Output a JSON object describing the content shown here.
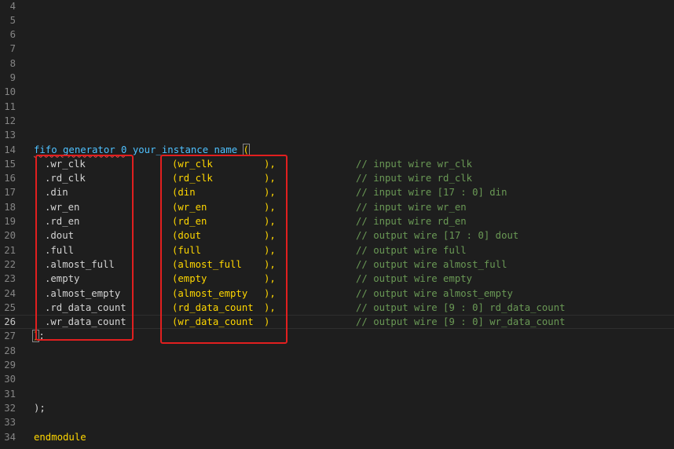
{
  "editor": {
    "empty_lines": [
      {
        "num": "4"
      },
      {
        "num": "5"
      },
      {
        "num": "6"
      },
      {
        "num": "7"
      },
      {
        "num": "8"
      },
      {
        "num": "9"
      },
      {
        "num": "10"
      },
      {
        "num": "11"
      },
      {
        "num": "12"
      },
      {
        "num": "13"
      }
    ],
    "instance_line": {
      "num": "14",
      "module": "fifo_generator_0",
      "instance": "your_instance_name",
      "open_paren": "("
    },
    "ports": [
      {
        "num": "15",
        "port": ".wr_clk",
        "signal": "(wr_clk",
        "close": "),",
        "comment": "// input wire wr_clk"
      },
      {
        "num": "16",
        "port": ".rd_clk",
        "signal": "(rd_clk",
        "close": "),",
        "comment": "// input wire rd_clk"
      },
      {
        "num": "17",
        "port": ".din",
        "signal": "(din",
        "close": "),",
        "comment": "// input wire [17 : 0] din"
      },
      {
        "num": "18",
        "port": ".wr_en",
        "signal": "(wr_en",
        "close": "),",
        "comment": "// input wire wr_en"
      },
      {
        "num": "19",
        "port": ".rd_en",
        "signal": "(rd_en",
        "close": "),",
        "comment": "// input wire rd_en"
      },
      {
        "num": "20",
        "port": ".dout",
        "signal": "(dout",
        "close": "),",
        "comment": "// output wire [17 : 0] dout"
      },
      {
        "num": "21",
        "port": ".full",
        "signal": "(full",
        "close": "),",
        "comment": "// output wire full"
      },
      {
        "num": "22",
        "port": ".almost_full",
        "signal": "(almost_full",
        "close": "),",
        "comment": "// output wire almost_full"
      },
      {
        "num": "23",
        "port": ".empty",
        "signal": "(empty",
        "close": "),",
        "comment": "// output wire empty"
      },
      {
        "num": "24",
        "port": ".almost_empty",
        "signal": "(almost_empty",
        "close": "),",
        "comment": "// output wire almost_empty"
      },
      {
        "num": "25",
        "port": ".rd_data_count",
        "signal": "(rd_data_count",
        "close": "),",
        "comment": "// output wire [9 : 0] rd_data_count"
      },
      {
        "num": "26",
        "port": ".wr_data_count",
        "signal": "(wr_data_count",
        "close": ")",
        "comment": "// output wire [9 : 0] wr_data_count"
      }
    ],
    "close_line": {
      "num": "27",
      "text": ");"
    },
    "blank_after": [
      {
        "num": "28"
      },
      {
        "num": "29"
      },
      {
        "num": "30"
      },
      {
        "num": "31"
      }
    ],
    "end_paren_line": {
      "num": "32",
      "text": ");"
    },
    "blank_33": {
      "num": "33"
    },
    "endmodule_line": {
      "num": "34",
      "text": "endmodule"
    },
    "current_line": "26"
  },
  "colors": {
    "background": "#1e1e1e",
    "line_number": "#858585",
    "comment": "#6a9955",
    "identifier": "#4fc1ff",
    "bracket": "#ffd700",
    "annotation_box": "#e11f1f"
  }
}
